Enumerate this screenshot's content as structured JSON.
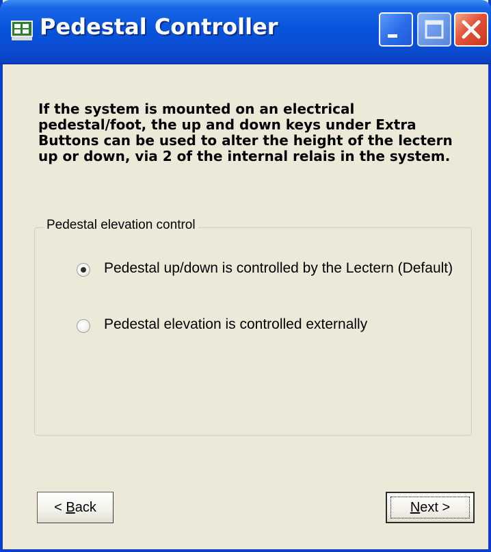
{
  "window": {
    "title": "Pedestal Controller",
    "icon": "app-icon",
    "controls": [
      "minimize-icon",
      "maximize-icon",
      "close-icon"
    ]
  },
  "description": "If the system is mounted on an electrical\npedestal/foot, the up and down keys under Extra\nButtons can be used to alter the height of the lectern\nup or down, via 2 of the internal relais in the system.",
  "group": {
    "label": "Pedestal elevation control",
    "options": [
      {
        "label": "Pedestal up/down is controlled by the Lectern (Default)",
        "selected": true
      },
      {
        "label": "Pedestal elevation is controlled externally",
        "selected": false
      }
    ]
  },
  "buttons": {
    "back": {
      "prefix": "< ",
      "mnemonic": "B",
      "rest": "ack"
    },
    "next": {
      "mnemonic": "N",
      "rest": "ext >"
    }
  },
  "colors": {
    "titlebar": "#0854DC",
    "dialog_bg": "#ECE9D8",
    "close_button": "#E2533A"
  }
}
